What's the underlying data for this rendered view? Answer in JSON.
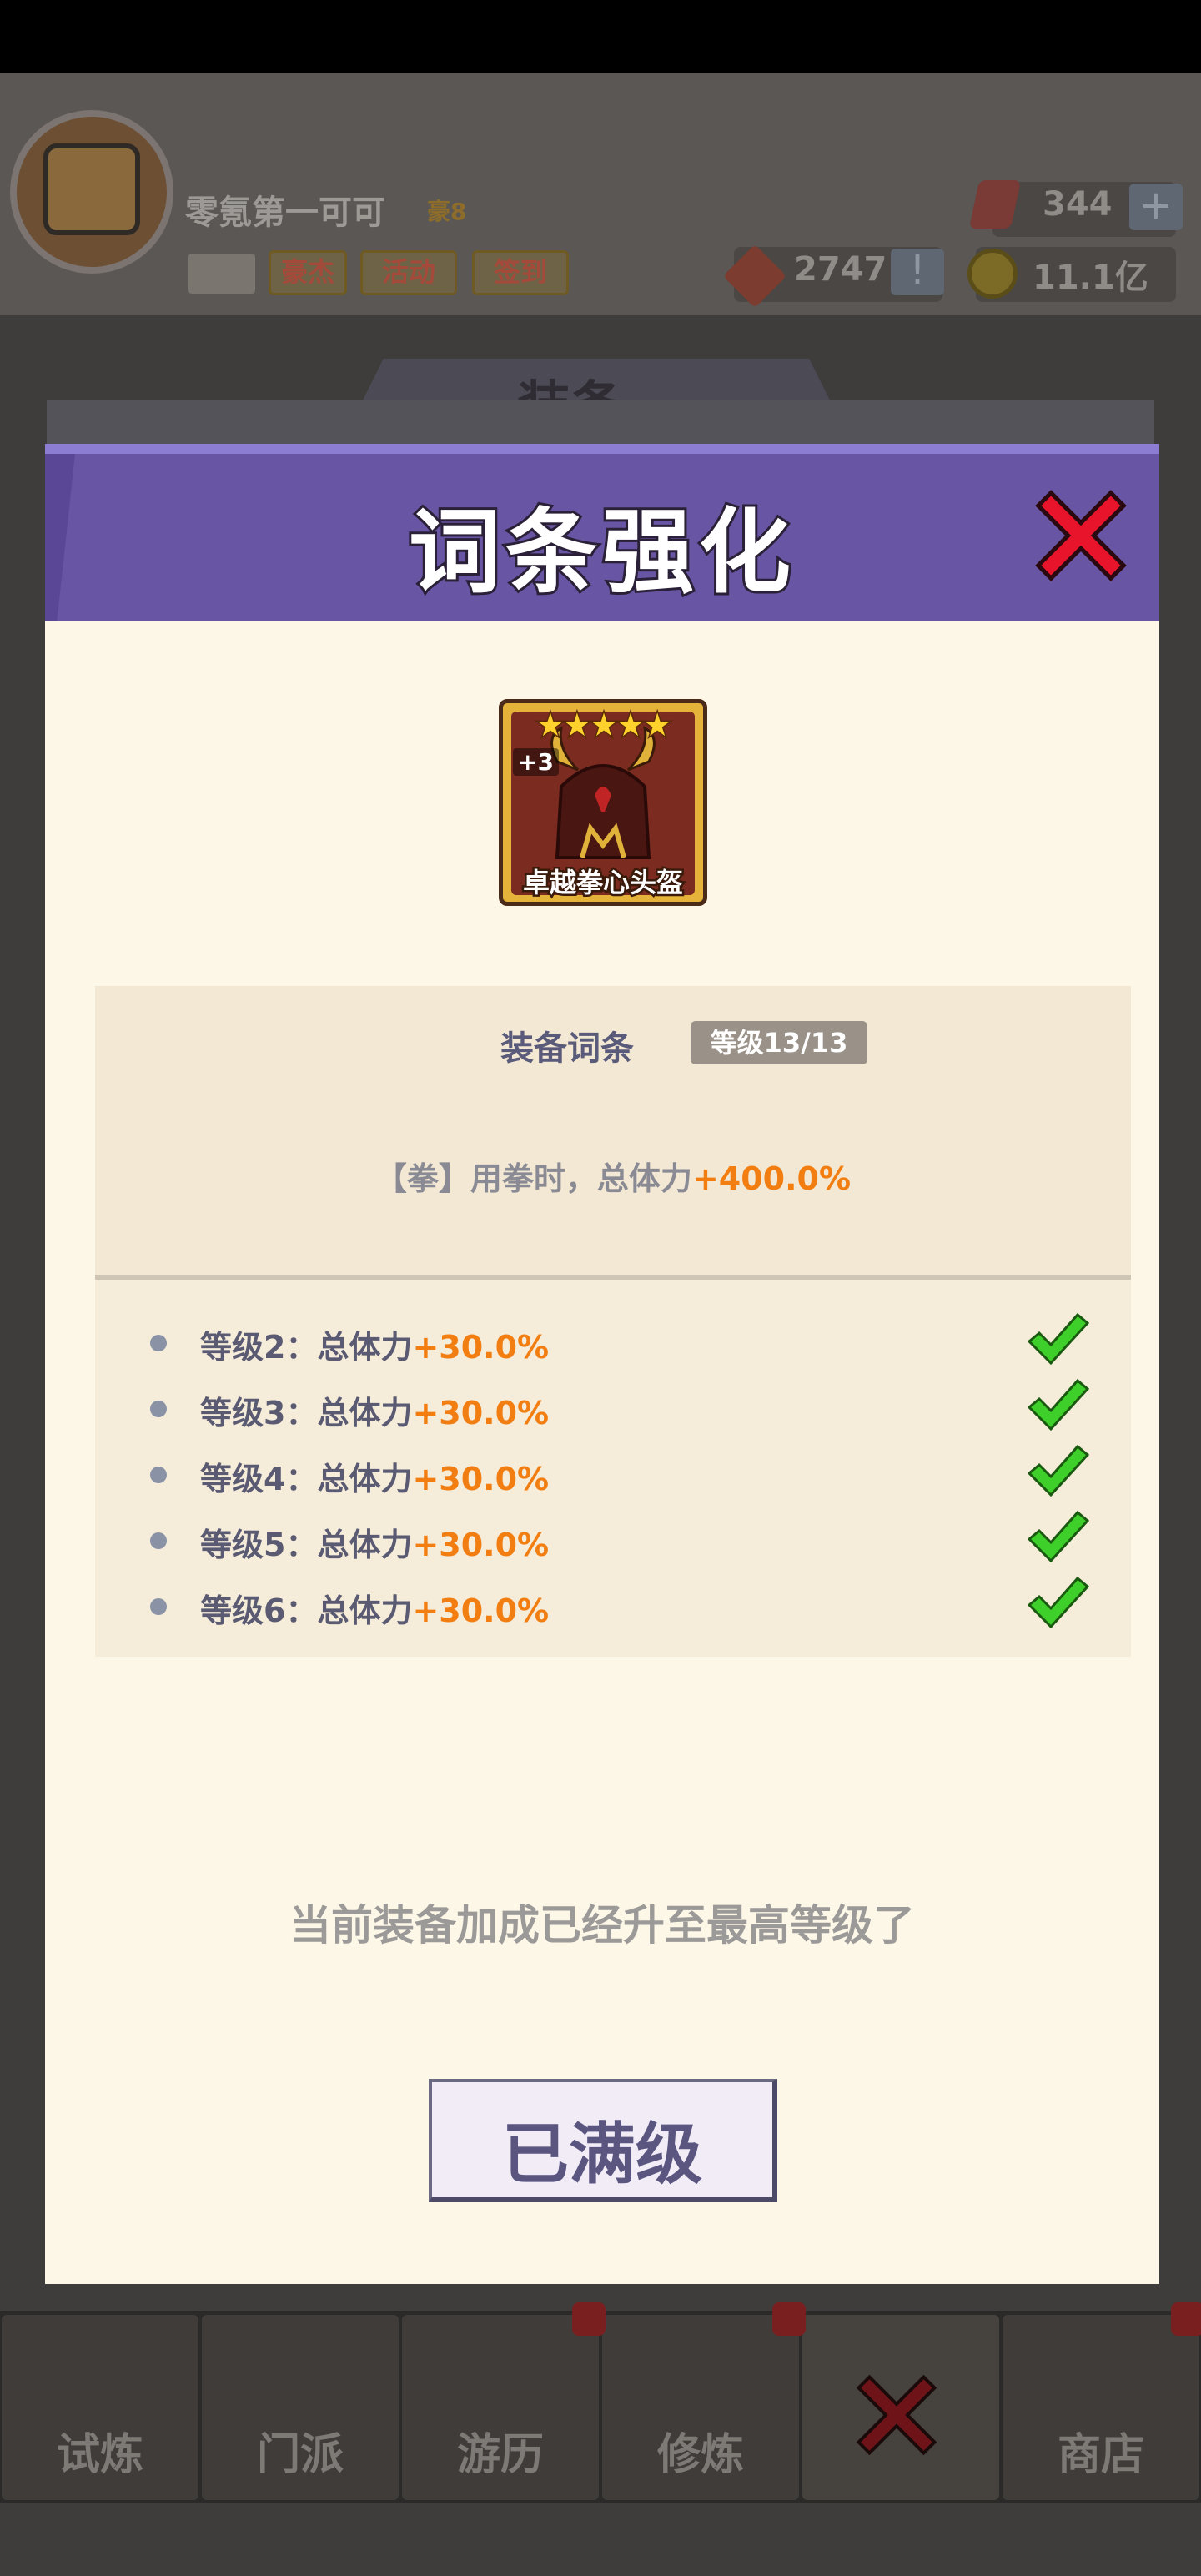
{
  "player": {
    "name": "零氪第一可可",
    "vip": "豪8"
  },
  "header_buttons": {
    "hero": "豪杰",
    "activity": "活动",
    "signin": "签到"
  },
  "resources": {
    "gems": "344",
    "tokens": "2747",
    "coins": "11.1亿",
    "plus": "+",
    "alert": "!"
  },
  "background": {
    "page_title": "装备"
  },
  "modal": {
    "title": "词条强化",
    "item": {
      "stars": "★★★★★",
      "plus": "+3",
      "name": "卓越拳心头盔"
    },
    "affix": {
      "title": "装备词条",
      "level": "等级13/13",
      "main_prefix": "【拳】用拳时，总体力",
      "main_value": "+400.0%"
    },
    "levels": [
      {
        "label": "等级2：总体力",
        "value": "+30.0%"
      },
      {
        "label": "等级3：总体力",
        "value": "+30.0%"
      },
      {
        "label": "等级4：总体力",
        "value": "+30.0%"
      },
      {
        "label": "等级5：总体力",
        "value": "+30.0%"
      },
      {
        "label": "等级6：总体力",
        "value": "+30.0%"
      }
    ],
    "max_note": "当前装备加成已经升至最高等级了",
    "max_button": "已满级"
  },
  "nav": {
    "trial": "试炼",
    "sect": "门派",
    "travel": "游历",
    "cultivate": "修炼",
    "shop": "商店"
  },
  "colors": {
    "header": "#6855a3",
    "accent_orange": "#f27e12",
    "check_green": "#3fcf2a",
    "close_red": "#e8142c"
  }
}
